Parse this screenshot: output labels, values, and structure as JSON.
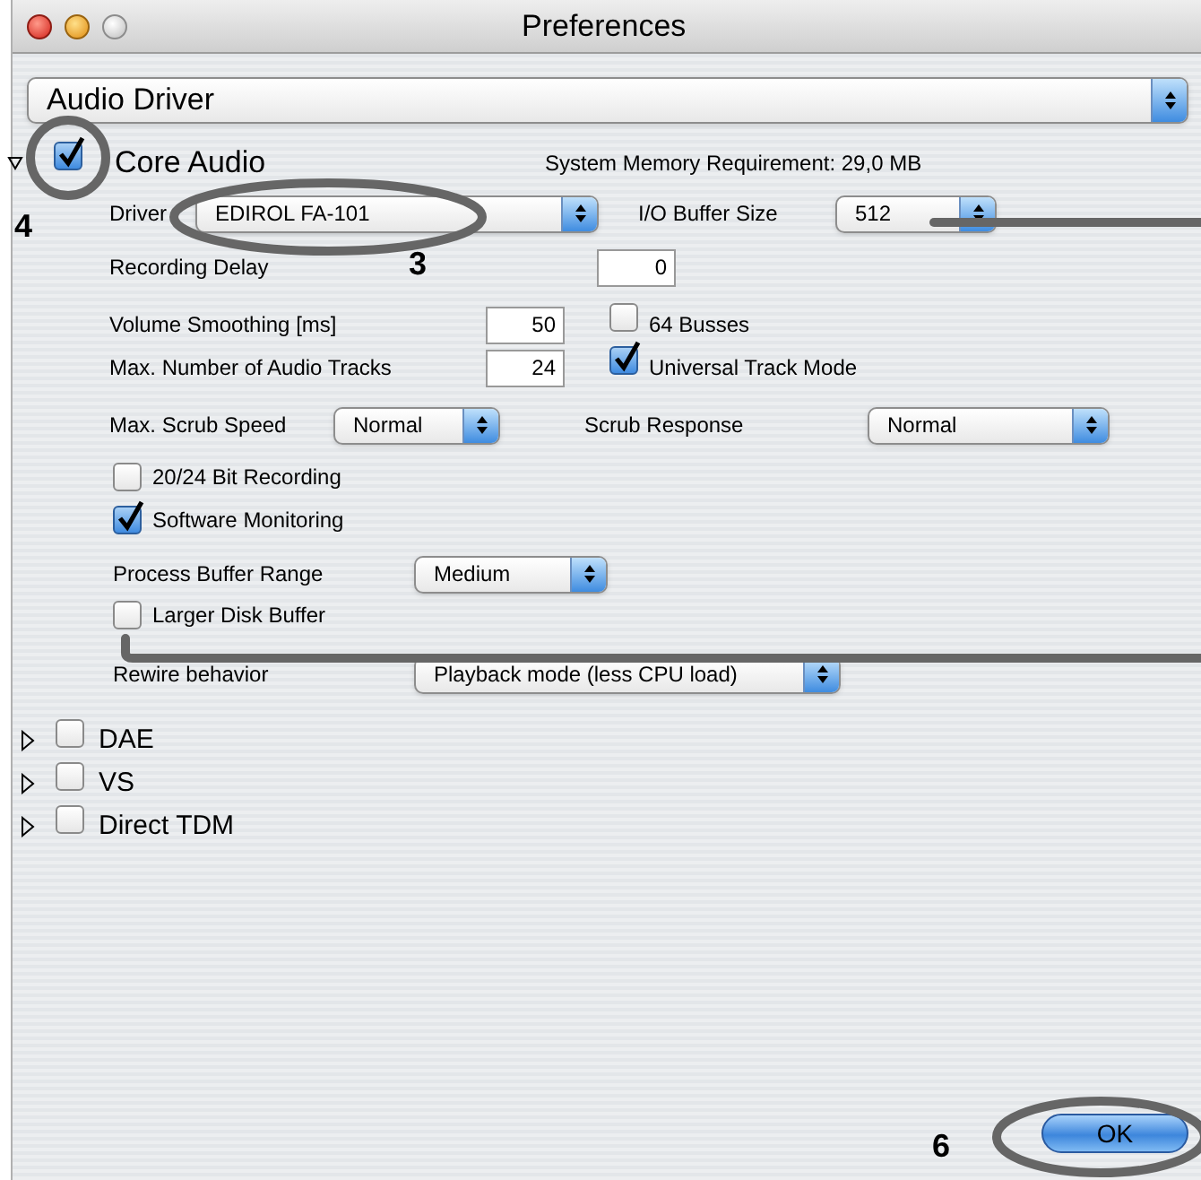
{
  "window": {
    "title": "Preferences"
  },
  "category_select": {
    "value": "Audio Driver"
  },
  "core_audio": {
    "name": "Core Audio",
    "expanded": true,
    "checked": true,
    "memory": "System Memory Requirement: 29,0 MB",
    "driver": {
      "label": "Driver",
      "value": "EDIROL FA-101"
    },
    "buffer_size": {
      "label": "I/O Buffer Size",
      "value": "512"
    },
    "recording_delay": {
      "label": "Recording Delay",
      "value": "0"
    },
    "volume_smoothing": {
      "label": "Volume Smoothing [ms]",
      "value": "50"
    },
    "busses_64": {
      "label": "64 Busses",
      "checked": false
    },
    "max_tracks": {
      "label": "Max. Number of Audio Tracks",
      "value": "24"
    },
    "universal_track_mode": {
      "label": "Universal Track Mode",
      "checked": true
    },
    "scrub_speed": {
      "label": "Max. Scrub Speed",
      "value": "Normal"
    },
    "scrub_response": {
      "label": "Scrub Response",
      "value": "Normal"
    },
    "bit_recording": {
      "label": "20/24 Bit Recording",
      "checked": false
    },
    "software_monitoring": {
      "label": "Software Monitoring",
      "checked": true
    },
    "process_buffer": {
      "label": "Process Buffer Range",
      "value": "Medium"
    },
    "larger_disk_buffer": {
      "label": "Larger Disk Buffer",
      "checked": false
    },
    "rewire": {
      "label": "Rewire behavior",
      "value": "Playback mode (less CPU load)"
    }
  },
  "other_drivers": [
    {
      "name": "DAE",
      "expanded": false,
      "checked": false
    },
    {
      "name": "VS",
      "expanded": false,
      "checked": false
    },
    {
      "name": "Direct TDM",
      "expanded": false,
      "checked": false
    }
  ],
  "ok_button": {
    "label": "OK"
  },
  "callouts": [
    {
      "label": "4"
    },
    {
      "label": "3"
    },
    {
      "label": "6"
    }
  ]
}
